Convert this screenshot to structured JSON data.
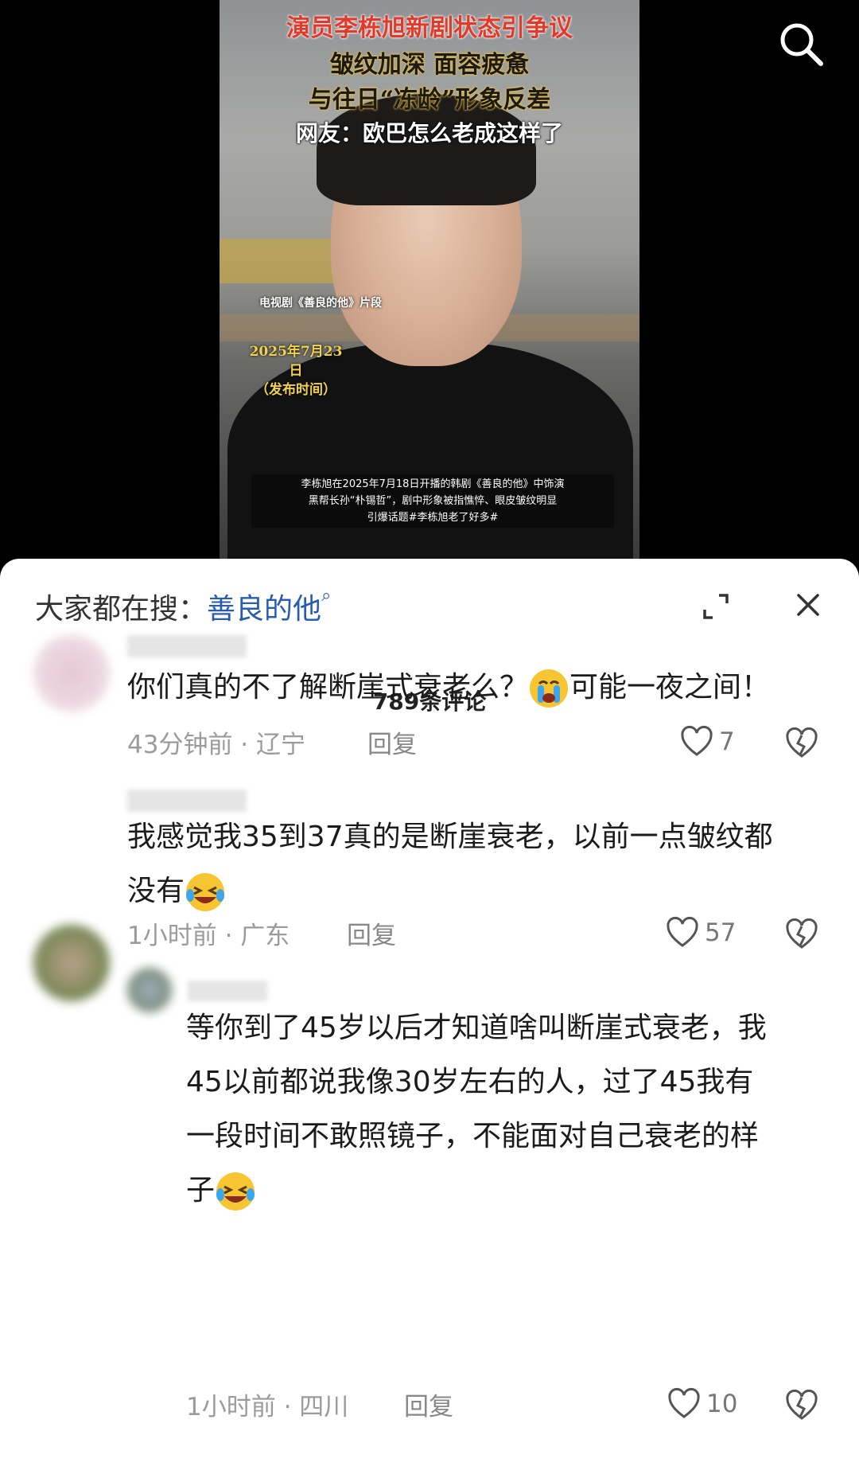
{
  "video": {
    "title_line1": "演员李栋旭新剧状态引争议",
    "title_line2": "皱纹加深 面容疲惫",
    "title_line3": "与往日“冻龄”形象反差",
    "title_line4": "网友：欧巴怎么老成这样了",
    "clip_label": "电视剧《善良的他》片段",
    "date_line1": "2025年7月23日",
    "date_line2": "（发布时间）",
    "caption_line1": "李栋旭在2025年7月18日开播的韩剧《善良的他》中饰演",
    "caption_line2": "黑帮长孙“朴锡哲”，剧中形象被指憔悴、眼皮皱纹明显",
    "caption_line3": "引爆话题#李栋旭老了好多#"
  },
  "search_bar": {
    "prefix": "大家都在搜：",
    "keyword": "善良的他"
  },
  "comments_count": "789条评论",
  "comments": [
    {
      "text_before_emoji": "你们真的不了解断崖式衰老么？",
      "text_after_emoji": "可能一夜之间！",
      "emoji": "crying-face",
      "time": "43分钟前",
      "location": "辽宁",
      "reply": "回复",
      "likes": "7"
    },
    {
      "text_line1": "我感觉我35到37真的是断崖衰老，以前一点皱纹都",
      "text_line2": "没有",
      "emoji": "laughing-tears-face",
      "time": "1小时前",
      "location": "广东",
      "reply": "回复",
      "likes": "57"
    },
    {
      "text_line1": "等你到了45岁以后才知道啥叫断崖式衰老，我",
      "text_line2": "45以前都说我像30岁左右的人，过了45我有",
      "text_line3": "一段时间不敢照镜子，不能面对自己衰老的样",
      "text_line4": "子",
      "emoji": "laughing-tears-face",
      "time": "1小时前",
      "location": "四川",
      "reply": "回复",
      "likes": "10"
    }
  ],
  "colors": {
    "keyword_blue": "#2a5cae",
    "title_red": "#e13a2a",
    "highlight_yellow": "#f1c23a"
  }
}
